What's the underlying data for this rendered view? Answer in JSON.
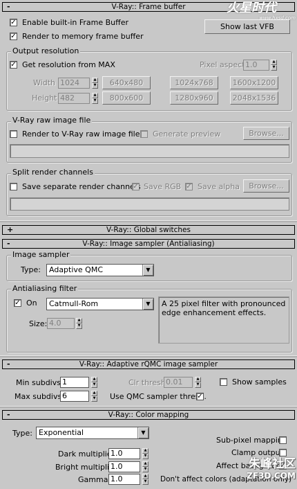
{
  "watermark_top": {
    "text": "火星时代",
    "url": "www.hxsd.com"
  },
  "watermark_bottom": {
    "text": "朱峰社区",
    "url": "ZF3D.COM"
  },
  "frame_buffer": {
    "title": "V-Ray:: Frame buffer",
    "enable_builtin": "Enable built-in Frame Buffer",
    "render_to_memory": "Render to memory frame buffer",
    "show_last_vfb": "Show last VFB",
    "output_resolution": {
      "label": "Output resolution",
      "get_from_max": "Get resolution from MAX",
      "pixel_aspect_label": "Pixel aspect:",
      "pixel_aspect_value": "1.0",
      "width_label": "Width",
      "width_value": "1024",
      "height_label": "Height",
      "height_value": "482",
      "presets": [
        "640x480",
        "1024x768",
        "1600x1200",
        "800x600",
        "1280x960",
        "2048x1536"
      ]
    },
    "raw_image": {
      "label": "V-Ray raw image file",
      "render_to_raw": "Render to V-Ray raw image file",
      "generate_preview": "Generate preview",
      "browse": "Browse..."
    },
    "split_channels": {
      "label": "Split render channels",
      "save_separate": "Save separate render channels",
      "save_rgb": "Save RGB",
      "save_alpha": "Save alpha",
      "browse": "Browse..."
    }
  },
  "global_switches": {
    "sign": "+",
    "title": "V-Ray:: Global switches"
  },
  "image_sampler": {
    "sign": "-",
    "title": "V-Ray:: Image sampler (Antialiasing)",
    "group_label": "Image sampler",
    "type_label": "Type:",
    "type_value": "Adaptive QMC",
    "aa_label": "Antialiasing filter",
    "on_label": "On",
    "filter_value": "Catmull-Rom",
    "filter_desc": "A 25 pixel filter with pronounced edge enhancement effects.",
    "size_label": "Size:",
    "size_value": "4.0"
  },
  "adaptive_qmc": {
    "sign": "-",
    "title": "V-Ray:: Adaptive rQMC image sampler",
    "min_label": "Min subdivs:",
    "min_value": "1",
    "max_label": "Max subdivs:",
    "max_value": "6",
    "clr_label": "Clr thresh:",
    "clr_value": "0.01",
    "show_samples": "Show samples",
    "use_qmc": "Use QMC sampler thresh."
  },
  "color_mapping": {
    "sign": "-",
    "title": "V-Ray:: Color mapping",
    "type_label": "Type:",
    "type_value": "Exponential",
    "subpixel": "Sub-pixel mapping",
    "clamp": "Clamp output",
    "affect_bg": "Affect background",
    "dark_label": "Dark multiplier:",
    "dark_value": "1.0",
    "bright_label": "Bright multiplier:",
    "bright_value": "1.0",
    "gamma_label": "Gamma:",
    "gamma_value": "1.0",
    "dont_affect": "Don't affect colors (adaptation only)"
  }
}
